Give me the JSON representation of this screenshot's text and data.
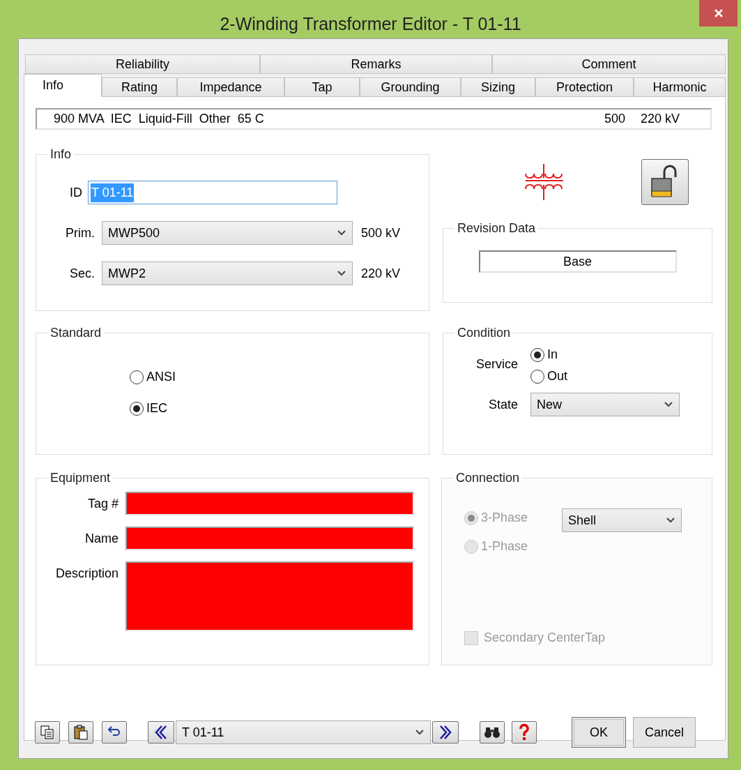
{
  "window": {
    "title": "2-Winding Transformer Editor - T 01-11"
  },
  "tab_rows": [
    [
      {
        "label": "Reliability",
        "selected": false
      },
      {
        "label": "Remarks",
        "selected": false
      },
      {
        "label": "Comment",
        "selected": false
      }
    ],
    [
      {
        "label": "Info",
        "selected": true
      },
      {
        "label": "Rating",
        "selected": false
      },
      {
        "label": "Impedance",
        "selected": false
      },
      {
        "label": "Tap",
        "selected": false
      },
      {
        "label": "Grounding",
        "selected": false
      },
      {
        "label": "Sizing",
        "selected": false
      },
      {
        "label": "Protection",
        "selected": false
      },
      {
        "label": "Harmonic",
        "selected": false
      }
    ]
  ],
  "summary": {
    "left": "900 MVA  IEC  Liquid-Fill  Other  65 C",
    "right_1": "500",
    "right_2": "220 kV"
  },
  "info": {
    "title": "Info",
    "id_label": "ID",
    "id_value": "T 01-11",
    "buses": [
      {
        "label": "Prim.",
        "value": "MWP500",
        "kv": "500 kV"
      },
      {
        "label": "Sec.",
        "value": "MWP2",
        "kv": "220 kV"
      }
    ]
  },
  "revision": {
    "title": "Revision Data",
    "value": "Base"
  },
  "standard": {
    "title": "Standard",
    "options": [
      {
        "label": "ANSI",
        "selected": false
      },
      {
        "label": "IEC",
        "selected": true
      }
    ]
  },
  "condition": {
    "title": "Condition",
    "service_label": "Service",
    "service_options": [
      {
        "label": "In",
        "selected": true
      },
      {
        "label": "Out",
        "selected": false
      }
    ],
    "state_label": "State",
    "state_value": "New"
  },
  "equipment": {
    "title": "Equipment",
    "fields": [
      {
        "label": "Tag #",
        "kind": "line",
        "flagged": true
      },
      {
        "label": "Name",
        "kind": "line",
        "flagged": true
      },
      {
        "label": "Description",
        "kind": "area",
        "flagged": true
      }
    ]
  },
  "connection": {
    "title": "Connection",
    "disabled": true,
    "phase_options": [
      {
        "label": "3-Phase",
        "selected": true
      },
      {
        "label": "1-Phase",
        "selected": false
      }
    ],
    "type_value": "Shell",
    "center_tap": {
      "label": "Secondary CenterTap",
      "checked": false
    }
  },
  "navigator": {
    "value": "T 01-11"
  },
  "buttons": [
    {
      "label": "OK",
      "kind": "default"
    },
    {
      "label": "Cancel",
      "kind": "normal"
    }
  ]
}
